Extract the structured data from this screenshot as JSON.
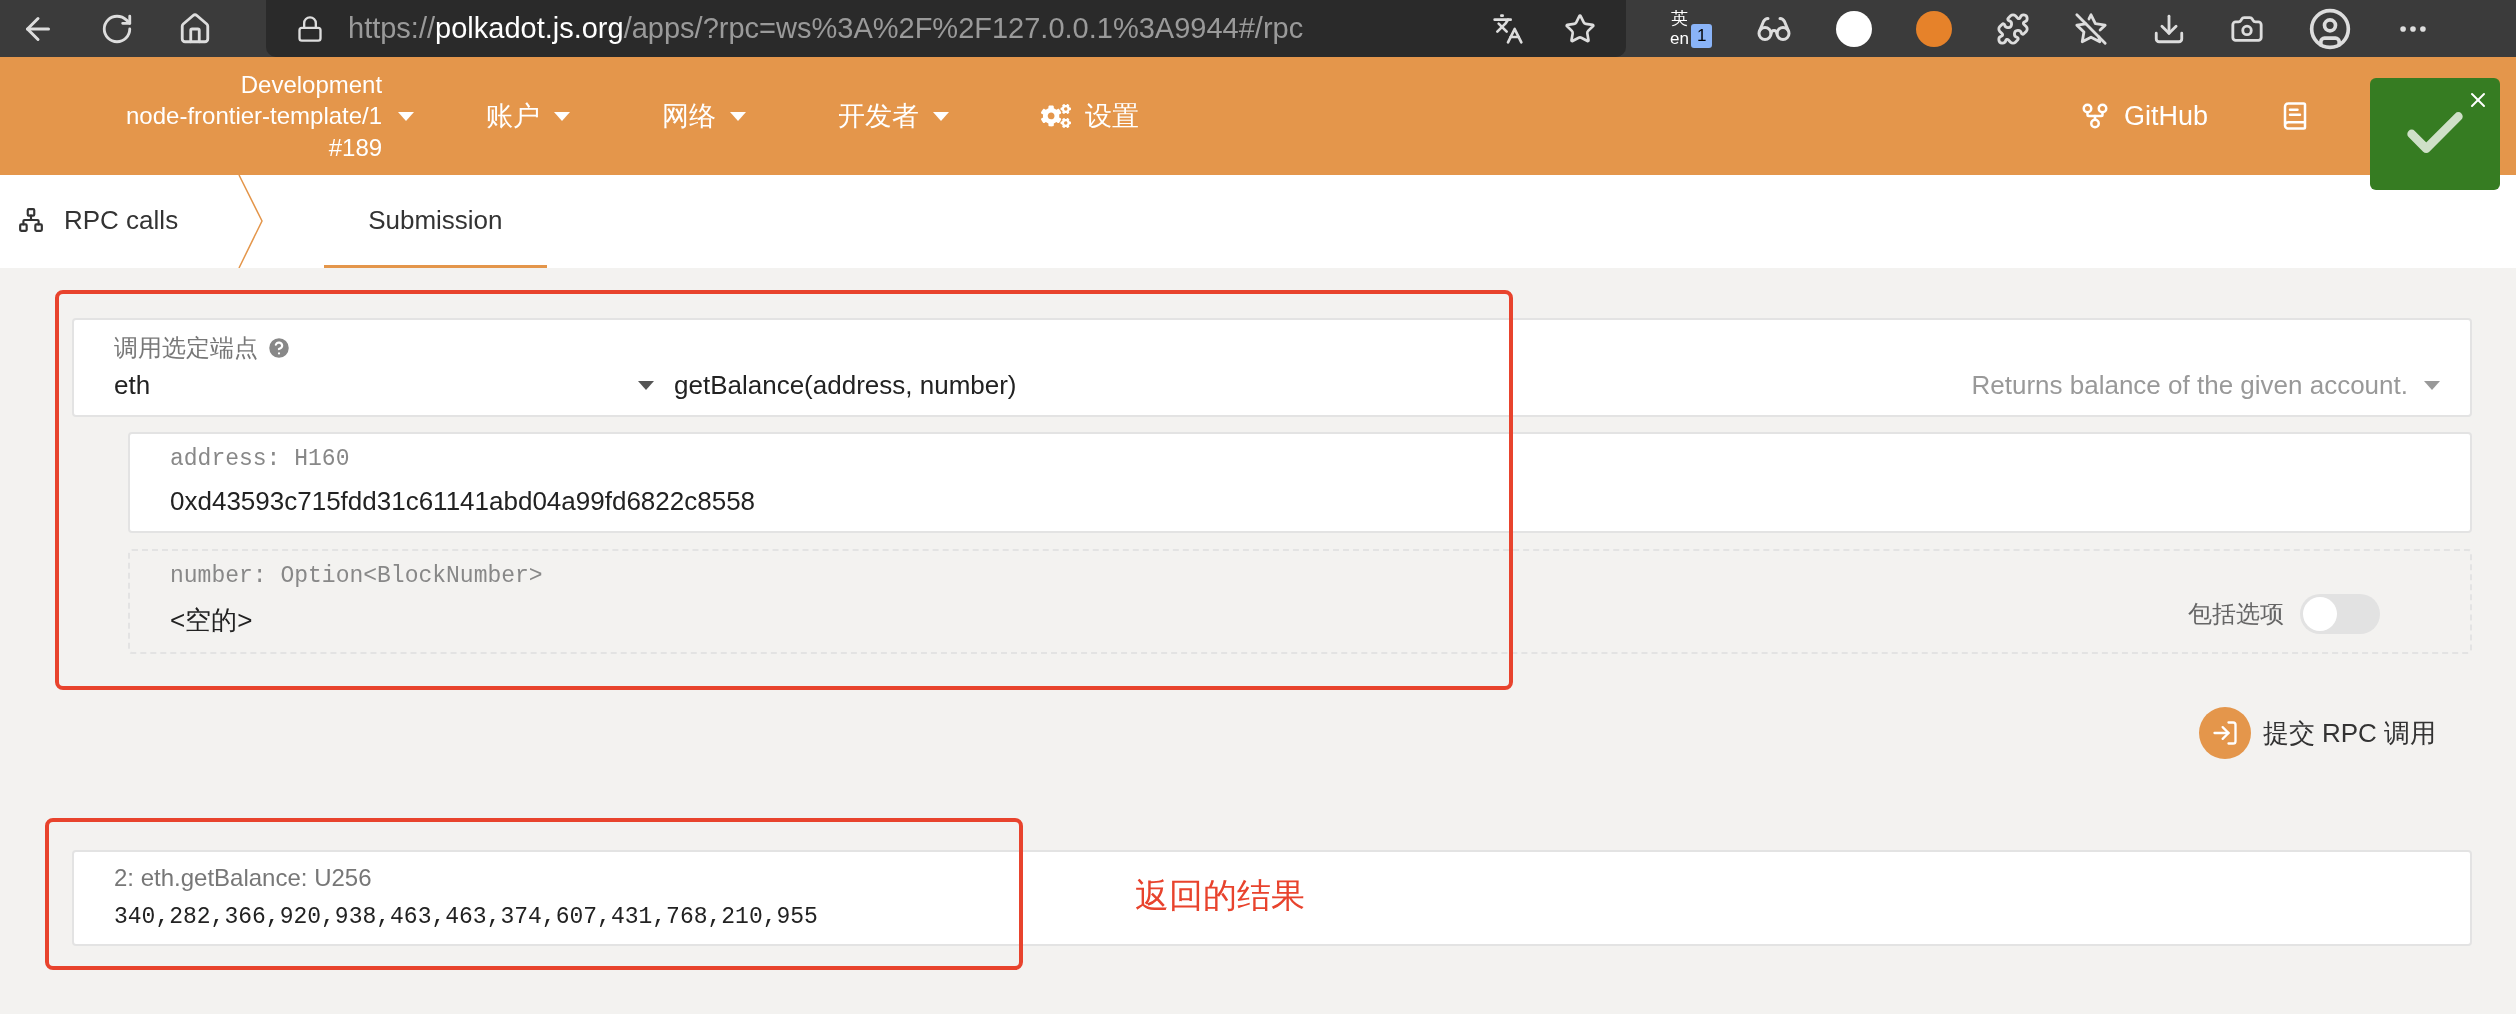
{
  "browser": {
    "url_scheme": "https://",
    "url_host": "polkadot.js.org",
    "url_path": "/apps/?rpc=ws%3A%2F%2F127.0.0.1%3A9944#/rpc",
    "translate_en": "en",
    "translate_zh": "英",
    "extension_badge": "1"
  },
  "header": {
    "chain": [
      "Development",
      "node-frontier-template/1",
      "#189"
    ],
    "menus": [
      {
        "label": "账户",
        "kind": "dropdown"
      },
      {
        "label": "网络",
        "kind": "dropdown"
      },
      {
        "label": "开发者",
        "kind": "dropdown"
      },
      {
        "label": "设置",
        "kind": "settings"
      }
    ],
    "links": [
      {
        "label": "GitHub",
        "kind": "github"
      },
      {
        "kind": "docs"
      }
    ]
  },
  "tabs": [
    {
      "label": "RPC calls",
      "selected": false,
      "kind": "root"
    },
    {
      "label": "Submission",
      "selected": true,
      "kind": "tab"
    }
  ],
  "form": {
    "endpoint_label": "调用选定端点",
    "section": "eth",
    "method": "getBalance(address, number)",
    "description": "Returns balance of the given account.",
    "params": [
      {
        "label": "address: H160",
        "value": "0xd43593c715fdd31c61141abd04a99fd6822c8558",
        "kind": "input"
      },
      {
        "label": "number: Option<BlockNumber>",
        "value": "<空的>",
        "kind": "optional",
        "toggle_label": "包括选项",
        "on": false
      }
    ]
  },
  "submit": "提交 RPC 调用",
  "results": [
    {
      "header": "2: eth.getBalance: U256",
      "value": "340,282,366,920,938,463,463,374,607,431,768,210,955"
    }
  ],
  "annotation": "返回的结果"
}
